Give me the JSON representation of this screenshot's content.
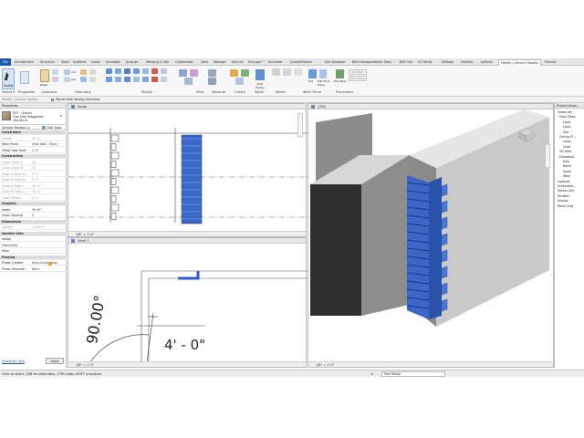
{
  "tabs": [
    "File",
    "Architecture",
    "Structure",
    "Steel",
    "Systems",
    "Insert",
    "Annotate",
    "Analyze",
    "Massing & Site",
    "Collaborate",
    "View",
    "Manage",
    "Add-Ins",
    "Enscape™",
    "Archilizer",
    "Quantification",
    "Site Designer",
    "BIM Interoperability Tools",
    "BIM One",
    "CS Revitr",
    "DiRoots",
    "Prolitics",
    "pyRevit",
    "Modify | Generic Models",
    "Precast"
  ],
  "ribbon_panels": [
    "Select ▾",
    "Properties",
    "Clipboard",
    "Geometry",
    "Modify",
    "View",
    "Measure",
    "Create",
    "Mode",
    "Model",
    "Work Plane",
    "Placement"
  ],
  "ribbon_buttons": {
    "modify": "Modify",
    "cut": "Cut",
    "join": "Join",
    "paste": "Paste",
    "edit_family": "Edit Family",
    "set": "Set",
    "show": "Show",
    "ref_plane": "Ref Plane",
    "viewer": "Viewer",
    "edit_work_plane": "Edit Work Plane",
    "pick_new": "Pick New",
    "pick_new_host": "Pick New Host",
    "work_plane": "Work Plane"
  },
  "options_bar": {
    "label": "Modify | Generic Models",
    "checkbox": "Moves With Nearby Elements"
  },
  "properties": {
    "header": "Properties",
    "type_name_1": "EST - Quoins",
    "type_name_2": "One Side Staggered -",
    "type_name_3": "10x10x12",
    "selector": "Generic Models (1)",
    "edit_type": "Edit Type",
    "help_link": "Properties help",
    "apply": "Apply",
    "rows": [
      {
        "k": "Constraints",
        "v": "",
        "sec": true
      },
      {
        "k": "Length",
        "v": "10' 0\"",
        "dim": true
      },
      {
        "k": "Work Plane",
        "v": "Exist Wall : Gene..."
      },
      {
        "k": "Offset from Host",
        "v": "0' 0\""
      },
      {
        "k": "Construction",
        "v": "",
        "sec": true
      },
      {
        "k": "Count Quoin A",
        "v": "10",
        "dim": true
      },
      {
        "k": "Count Quoin B",
        "v": "10",
        "dim": true
      },
      {
        "k": "Quoin A Start to...",
        "v": "0' 0\"",
        "dim": true
      },
      {
        "k": "Quoin B Start to...",
        "v": "0' 0\"",
        "dim": true
      },
      {
        "k": "Quoin A Total L...",
        "v": "10' 0\"",
        "dim": true
      },
      {
        "k": "Quoin B Total L...",
        "v": "10' 0\"",
        "dim": true
      },
      {
        "k": "Quoin Period",
        "v": "2' 0\"",
        "dim": true
      },
      {
        "k": "Graphics",
        "v": "",
        "sec": true
      },
      {
        "k": "Angle",
        "v": "90.00°"
      },
      {
        "k": "Quoin Spacing",
        "v": "0"
      },
      {
        "k": "Dimensions",
        "v": "",
        "sec": true
      },
      {
        "k": "Volume",
        "v": "15.00 CF",
        "dim": true
      },
      {
        "k": "Identity Data",
        "v": "",
        "sec": true
      },
      {
        "k": "Image",
        "v": ""
      },
      {
        "k": "Comments",
        "v": ""
      },
      {
        "k": "Mark",
        "v": ""
      },
      {
        "k": "Phasing",
        "v": "",
        "sec": true
      },
      {
        "k": "Phase Created",
        "v": "New Construction"
      },
      {
        "k": "Phase Demolish...",
        "v": "None"
      }
    ]
  },
  "views": {
    "south_title": "South",
    "south_scale": "1/8\" = 1'-0\"",
    "level_title": "Level 1",
    "level_scale": "1/8\" = 1'-0\"",
    "angle_text": "90.00°",
    "dim_text": "4' - 0\"",
    "view3d_title": "{3D}",
    "view3d_scale": "1/8\" = 1'-0\""
  },
  "browser": {
    "title": "Project Brow...",
    "items": [
      "Views (all)",
      "Floor Plans",
      "Level",
      "Level",
      "Site",
      "Ceiling Pl...",
      "Level",
      "Level",
      "3D View",
      "Elevations",
      "East",
      "North",
      "South",
      "West",
      "Legends",
      "Schedules/...",
      "Sheets (all)",
      "Families",
      "Groups",
      "Revit Links"
    ]
  },
  "status": {
    "text": "Click to select, TAB for alternates, CTRL adds, SHIFT unselects.",
    "model": "Main Model",
    "zero": ":0"
  },
  "colors": {
    "accent": "#1e5aa8",
    "quoin_blue": "#3a66c8",
    "wall_gray": "#8c8c8c",
    "wall_light": "#cfcfcf"
  }
}
